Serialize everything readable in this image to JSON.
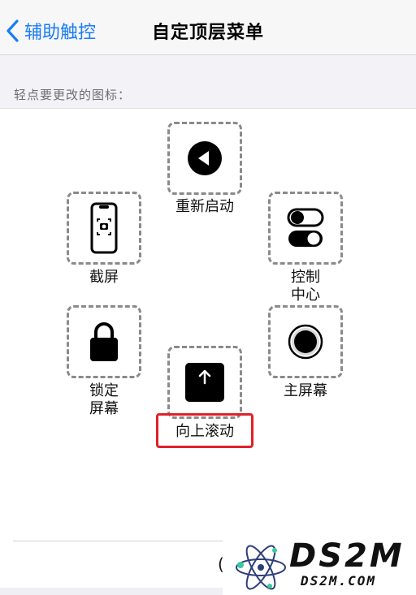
{
  "nav": {
    "back_label": "辅助触控",
    "title": "自定顶层菜单"
  },
  "section_header": "轻点要更改的图标：",
  "menu_items": [
    {
      "label": "重新启动",
      "icon": "play-back-icon"
    },
    {
      "label": "截屏",
      "icon": "phone-screenshot-icon"
    },
    {
      "label": "控制\n中心",
      "icon": "toggles-icon"
    },
    {
      "label": "锁定\n屏幕",
      "icon": "lock-icon"
    },
    {
      "label": "主屏幕",
      "icon": "home-circle-icon"
    },
    {
      "label": "向上滚动",
      "icon": "arrow-up-square-icon"
    }
  ],
  "watermark": {
    "main": "DS2M",
    "sub": "DS2M.COM"
  },
  "colors": {
    "accent": "#1a7cf5",
    "highlight": "#e0202a"
  }
}
